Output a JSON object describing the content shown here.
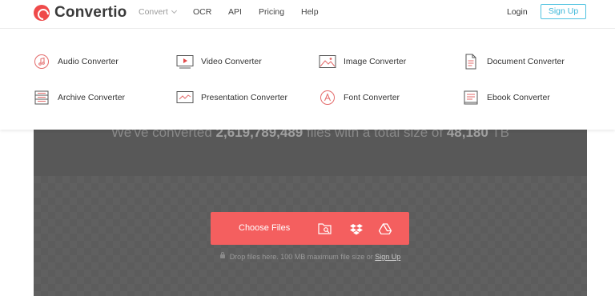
{
  "brand": {
    "name": "Convertio",
    "color": "#ef4a4a"
  },
  "nav": {
    "convert": "Convert",
    "ocr": "OCR",
    "api": "API",
    "pricing": "Pricing",
    "help": "Help",
    "login": "Login",
    "signup": "Sign Up"
  },
  "converters": [
    {
      "label": "Audio Converter",
      "icon": "music-note-icon"
    },
    {
      "label": "Video Converter",
      "icon": "video-play-icon"
    },
    {
      "label": "Image Converter",
      "icon": "image-icon"
    },
    {
      "label": "Document Converter",
      "icon": "document-icon"
    },
    {
      "label": "Archive Converter",
      "icon": "archive-icon"
    },
    {
      "label": "Presentation Converter",
      "icon": "presentation-icon"
    },
    {
      "label": "Font Converter",
      "icon": "font-icon"
    },
    {
      "label": "Ebook Converter",
      "icon": "ebook-icon"
    }
  ],
  "hero": {
    "stat_prefix": "We've converted",
    "files_count": "2,619,789,489",
    "stat_middle": "files with a total size of",
    "total_size": "48,180",
    "stat_unit": "TB"
  },
  "upload": {
    "choose_label": "Choose Files",
    "sources": [
      "folder-search-icon",
      "dropbox-icon",
      "google-drive-icon"
    ],
    "note": "Drop files here. 100 MB maximum file size or",
    "note_link": "Sign Up",
    "accent": "#f45f5f"
  }
}
